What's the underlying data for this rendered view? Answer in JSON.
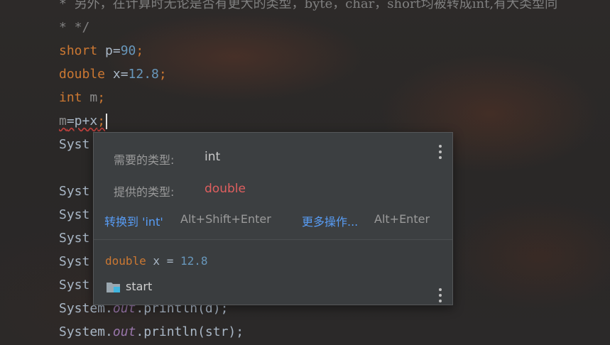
{
  "editor": {
    "lines": {
      "comment1": {
        "prefix": "* ",
        "text": "另外，在计算时无论是否有更大的类型，byte，char，short均被转成int,有大类型同"
      },
      "comment2": "* */",
      "l_short": {
        "kw": "short",
        "rest": " p=",
        "num": "90",
        "end": ";"
      },
      "l_double": {
        "kw": "double",
        "rest": " x=",
        "num": "12.8",
        "end": ";"
      },
      "l_int": {
        "kw": "int",
        "var": " m",
        "end": ";"
      },
      "l_assign": {
        "var": "m",
        "rest": "=p+x",
        "end": ";"
      },
      "l_syst1": "Syst",
      "l_syst2": "Syst",
      "l_syst3": "Syst",
      "l_syst4": "Syst",
      "l_syst5": "Syst",
      "l_syst6": "Syst",
      "l_print_d": {
        "a": "System.",
        "field": "out",
        "b": ".println(d);"
      },
      "l_print_str": {
        "a": "System.",
        "field": "out",
        "b": ".println(str);"
      }
    }
  },
  "popup": {
    "required_label": "需要的类型:",
    "required_value": "int",
    "provided_label": "提供的类型:",
    "provided_value": "double",
    "action1_label": "转换到 'int'",
    "action1_shortcut": "Alt+Shift+Enter",
    "action2_label": "更多操作...",
    "action2_shortcut": "Alt+Enter",
    "declaration": {
      "kw": "double",
      "mid": " x = ",
      "num": "12.8"
    },
    "location_label": "start",
    "icons": {
      "more": "vertical-dots-icon",
      "folder": "folder-icon"
    }
  },
  "colors": {
    "keyword": "#cc7832",
    "number": "#6897bb",
    "error_type": "#e05f5f",
    "link": "#589df6"
  }
}
